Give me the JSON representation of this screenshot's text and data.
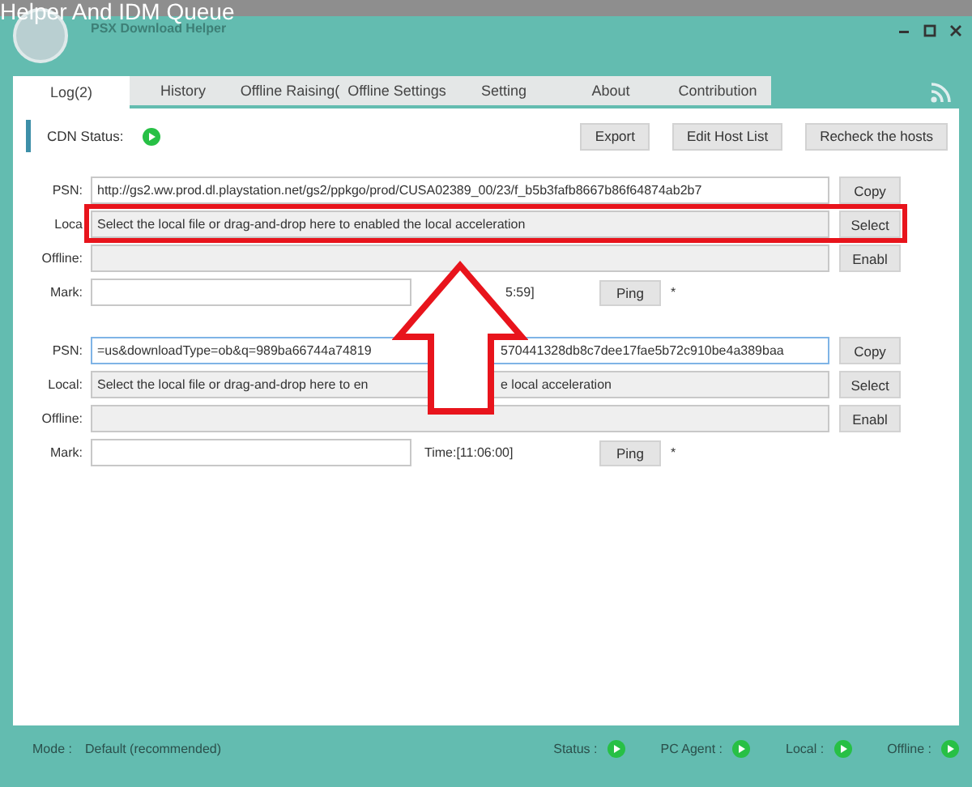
{
  "overlay_title": "Helper And IDM Queue",
  "window": {
    "title": "PSX Download Helper"
  },
  "tabs": [
    {
      "label": "Log(2)",
      "selected": true
    },
    {
      "label": "History",
      "selected": false
    },
    {
      "label": "Offline Raising(",
      "selected": false
    },
    {
      "label": "Offline Settings",
      "selected": false
    },
    {
      "label": "Setting",
      "selected": false
    },
    {
      "label": "About",
      "selected": false
    },
    {
      "label": "Contribution",
      "selected": false
    }
  ],
  "cdn": {
    "label": "CDN Status:",
    "ok": true
  },
  "toolbar_buttons": [
    "Export",
    "Edit Host List",
    "Recheck the hosts"
  ],
  "downloads": [
    {
      "psn_label": "PSN:",
      "psn_parts": [
        "http://gs2.ww.prod.dl.playstation.net/gs2/ppkgo/prod/CUSA02389_00/23/f_b5b3fafb8667b86f64874ab2b7"
      ],
      "psn_focused": false,
      "copy": "Copy",
      "local_label": "Loca",
      "local_parts": [
        "Select the local file or drag-and-drop here to enabled the local acceleration"
      ],
      "highlighted": true,
      "select": "Select",
      "offline_label": "Offline:",
      "enable": "Enabl",
      "mark_label": "Mark:",
      "time_parts": [
        "5:59]"
      ],
      "ping": "Ping",
      "ping_mark": "*"
    },
    {
      "psn_label": "PSN:",
      "psn_parts": [
        "=us&downloadType=ob&q=989ba66744a74819",
        "570441328db8c7dee17fae5b72c910be4a389baa"
      ],
      "psn_focused": true,
      "copy": "Copy",
      "local_label": "Local:",
      "local_parts": [
        "Select the local file or drag-and-drop here to en",
        "e local acceleration"
      ],
      "highlighted": false,
      "select": "Select",
      "offline_label": "Offline:",
      "enable": "Enabl",
      "mark_label": "Mark:",
      "time_parts": [
        "Time:[11:06:00]"
      ],
      "ping": "Ping",
      "ping_mark": "*"
    }
  ],
  "status_bar": {
    "mode_label": "Mode :",
    "mode_value": "Default (recommended)",
    "indicators": [
      {
        "label": "Status :",
        "ok": true
      },
      {
        "label": "PC Agent :",
        "ok": true
      },
      {
        "label": "Local :",
        "ok": true
      },
      {
        "label": "Offline :",
        "ok": true
      }
    ]
  }
}
